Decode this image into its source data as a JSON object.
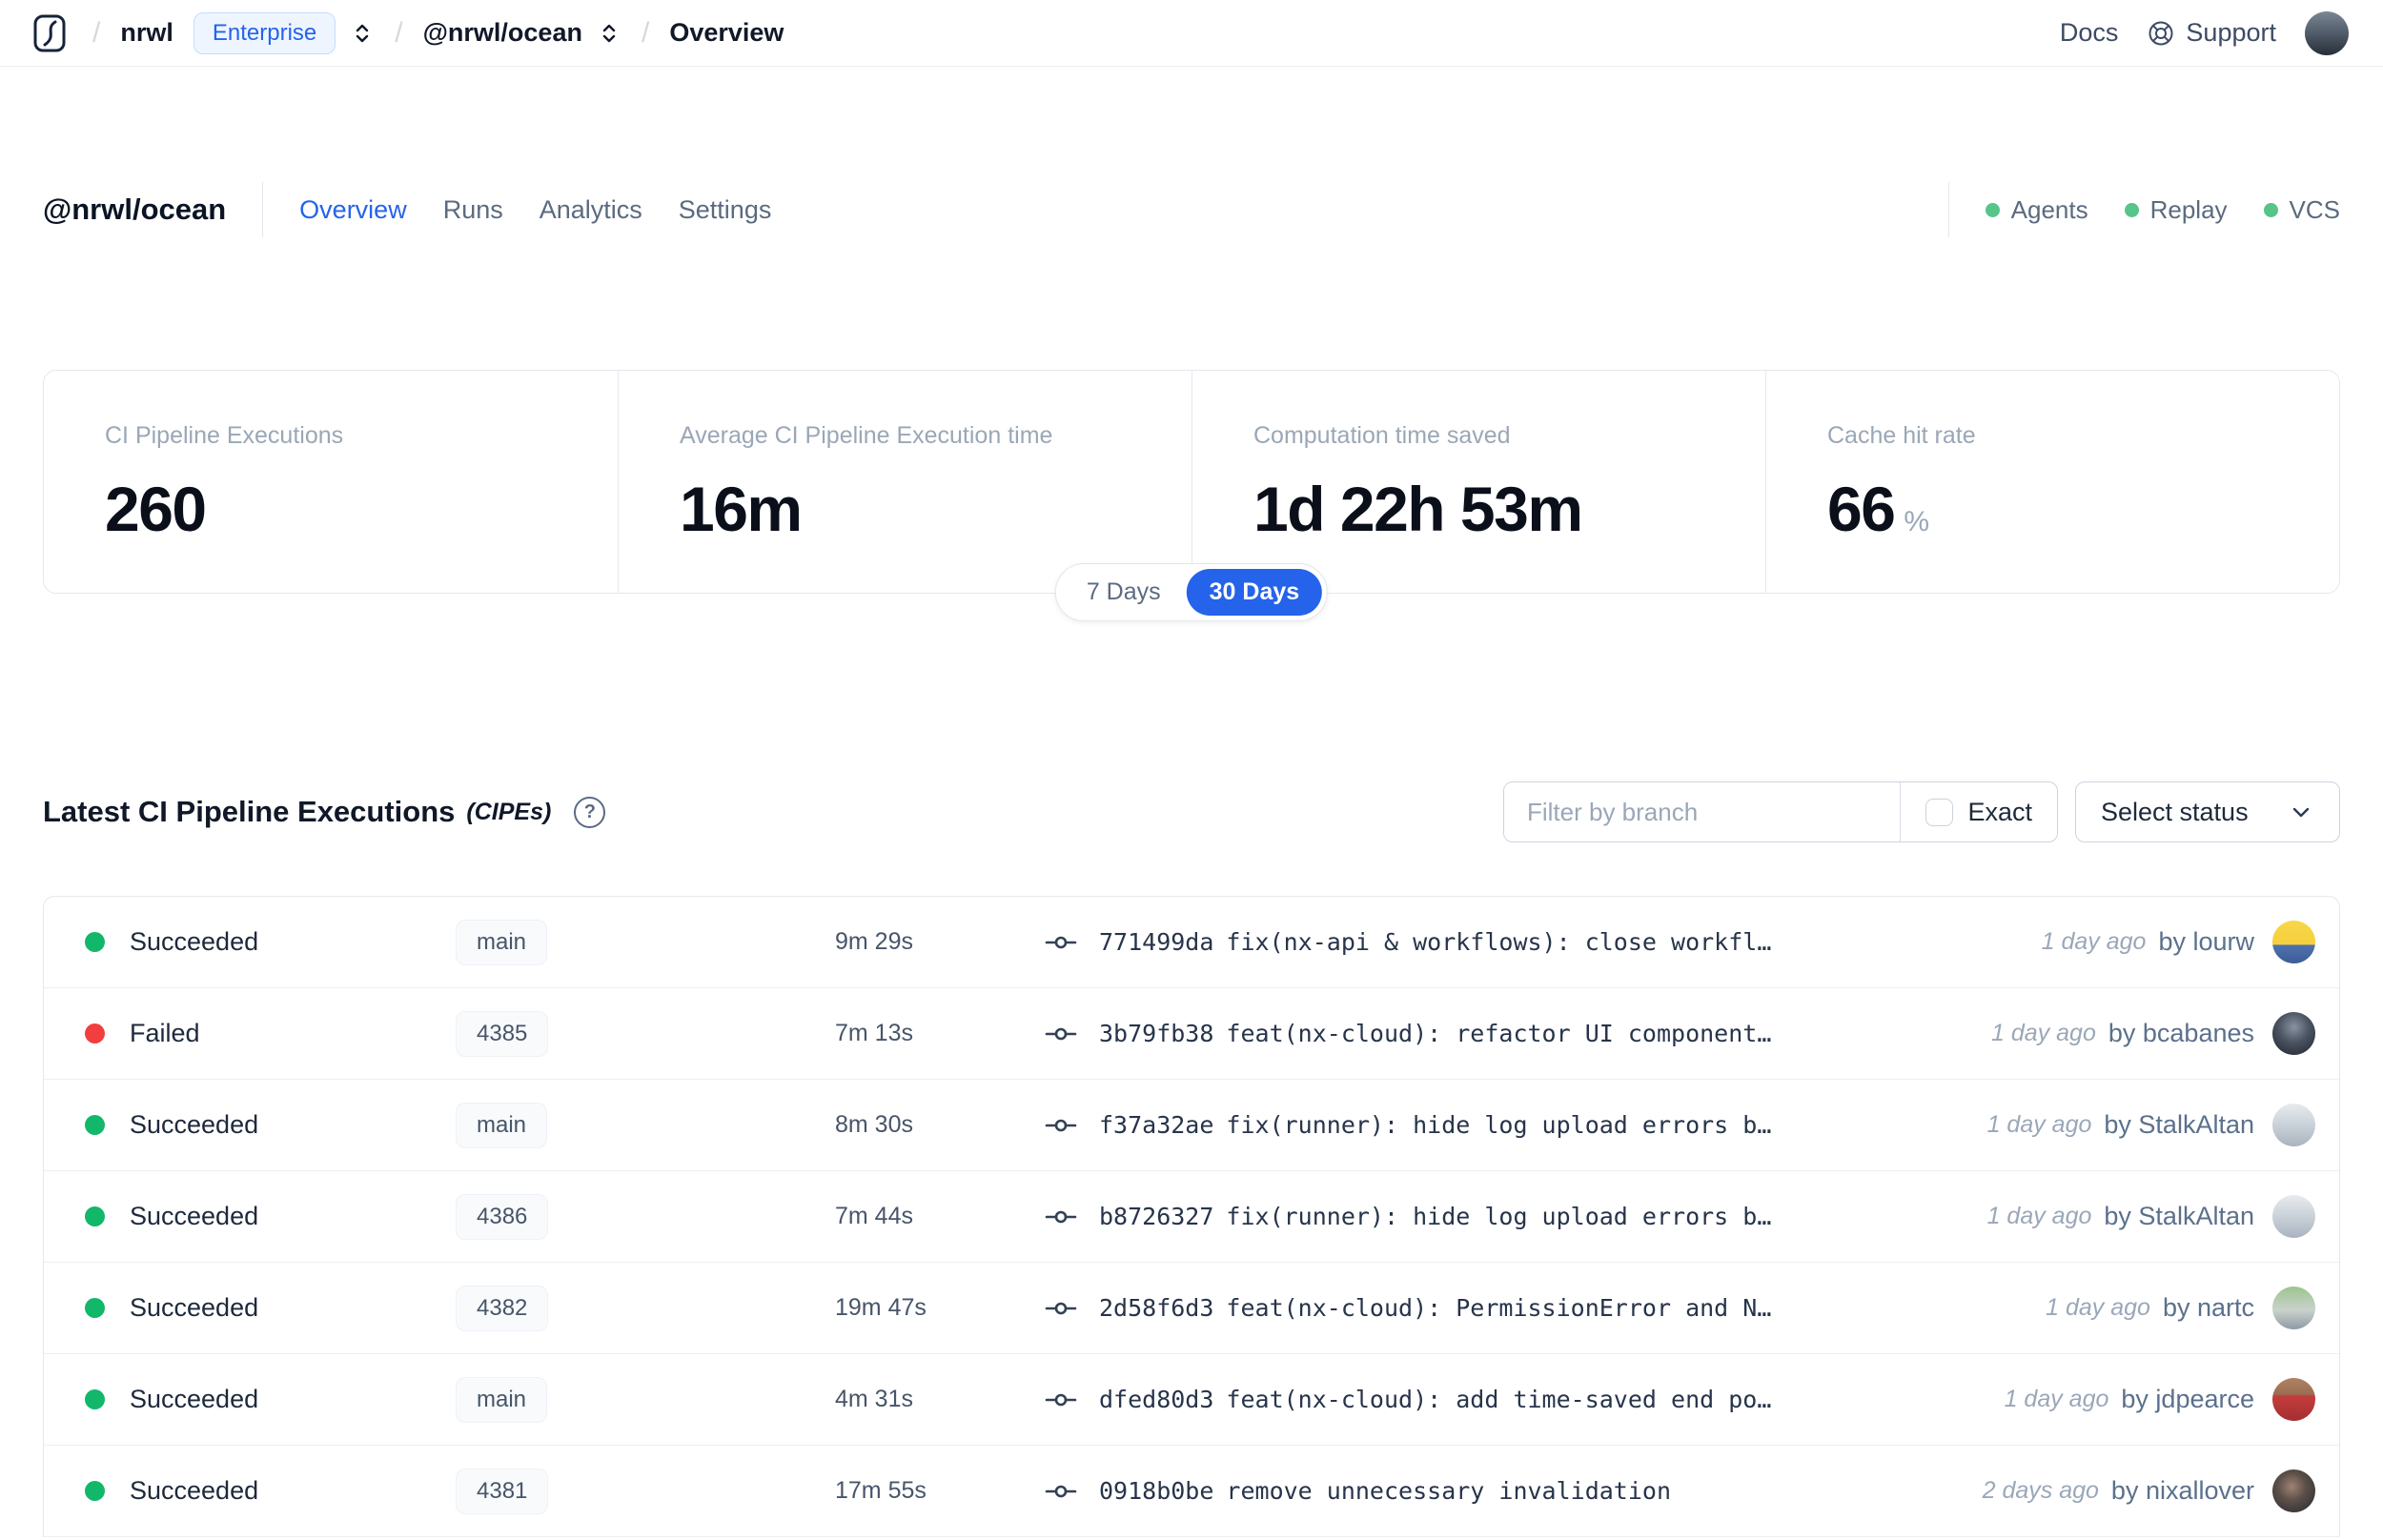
{
  "colors": {
    "accent": "#2563eb",
    "feature_dot_green": "#57c489",
    "success_green": "#12b76a",
    "failed_red": "#f23e3e"
  },
  "navbar": {
    "breadcrumb": {
      "org": "nrwl",
      "org_badge": "Enterprise",
      "workspace": "@nrwl/ocean",
      "page": "Overview"
    },
    "links": {
      "docs": "Docs",
      "support": "Support"
    }
  },
  "header": {
    "title": "@nrwl/ocean",
    "tabs": [
      {
        "label": "Overview",
        "active": true
      },
      {
        "label": "Runs",
        "active": false
      },
      {
        "label": "Analytics",
        "active": false
      },
      {
        "label": "Settings",
        "active": false
      }
    ],
    "features": [
      {
        "label": "Agents"
      },
      {
        "label": "Replay"
      },
      {
        "label": "VCS"
      }
    ]
  },
  "stats": {
    "cards": [
      {
        "label": "CI Pipeline Executions",
        "value": "260",
        "suffix": ""
      },
      {
        "label": "Average CI Pipeline Execution time",
        "value": "16m",
        "suffix": ""
      },
      {
        "label": "Computation time saved",
        "value": "1d 22h 53m",
        "suffix": ""
      },
      {
        "label": "Cache hit rate",
        "value": "66",
        "suffix": "%"
      }
    ],
    "range_toggle": {
      "options": [
        "7 Days",
        "30 Days"
      ],
      "selected": "30 Days"
    }
  },
  "cipe_section": {
    "title": "Latest CI Pipeline Executions",
    "title_suffix": "(CIPEs)",
    "filter_placeholder": "Filter by branch",
    "exact_label": "Exact",
    "status_select_label": "Select status",
    "rows": [
      {
        "status": "Succeeded",
        "status_color": "#12b76a",
        "branch": "main",
        "duration": "9m 29s",
        "commit_hash": "771499da",
        "commit_message": "fix(nx-api & workflows): close workfl…",
        "ago": "1 day ago",
        "author": "by lourw",
        "avatar_gradient": "linear-gradient(180deg,#f8d74a 0%,#f5cf3d 55%,#4e71ad 58%,#3c5c96 100%)"
      },
      {
        "status": "Failed",
        "status_color": "#f23e3e",
        "branch": "4385",
        "duration": "7m 13s",
        "commit_hash": "3b79fb38",
        "commit_message": "feat(nx-cloud): refactor UI component…",
        "ago": "1 day ago",
        "author": "by bcabanes",
        "avatar_gradient": "radial-gradient(circle at 50% 35%,#8a93a2 0%,#4a5260 45%,#1f252e 100%)"
      },
      {
        "status": "Succeeded",
        "status_color": "#12b76a",
        "branch": "main",
        "duration": "8m 30s",
        "commit_hash": "f37a32ae",
        "commit_message": "fix(runner): hide log upload errors b…",
        "ago": "1 day ago",
        "author": "by StalkAltan",
        "avatar_gradient": "linear-gradient(180deg,#e8ebef 0%,#cdd4db 45%,#aab3bf 100%)"
      },
      {
        "status": "Succeeded",
        "status_color": "#12b76a",
        "branch": "4386",
        "duration": "7m 44s",
        "commit_hash": "b8726327",
        "commit_message": "fix(runner): hide log upload errors b…",
        "ago": "1 day ago",
        "author": "by StalkAltan",
        "avatar_gradient": "linear-gradient(180deg,#e8ebef 0%,#cdd4db 45%,#aab3bf 100%)"
      },
      {
        "status": "Succeeded",
        "status_color": "#12b76a",
        "branch": "4382",
        "duration": "19m 47s",
        "commit_hash": "2d58f6d3",
        "commit_message": "feat(nx-cloud): PermissionError and N…",
        "ago": "1 day ago",
        "author": "by nartc",
        "avatar_gradient": "linear-gradient(180deg,#9cc48e 0%,#c9d2cc 55%,#8e9aa4 100%)"
      },
      {
        "status": "Succeeded",
        "status_color": "#12b76a",
        "branch": "main",
        "duration": "4m 31s",
        "commit_hash": "dfed80d3",
        "commit_message": "feat(nx-cloud): add time-saved end po…",
        "ago": "1 day ago",
        "author": "by jdpearce",
        "avatar_gradient": "linear-gradient(180deg,#b08263 0%,#9a6e52 38%,#c43d3d 42%,#a32f31 100%)"
      },
      {
        "status": "Succeeded",
        "status_color": "#12b76a",
        "branch": "4381",
        "duration": "17m 55s",
        "commit_hash": "0918b0be",
        "commit_message": "remove unnecessary invalidation",
        "ago": "2 days ago",
        "author": "by nixallover",
        "avatar_gradient": "radial-gradient(circle at 45% 40%,#a08274 0%,#5c5049 40%,#23272e 100%)"
      }
    ]
  }
}
